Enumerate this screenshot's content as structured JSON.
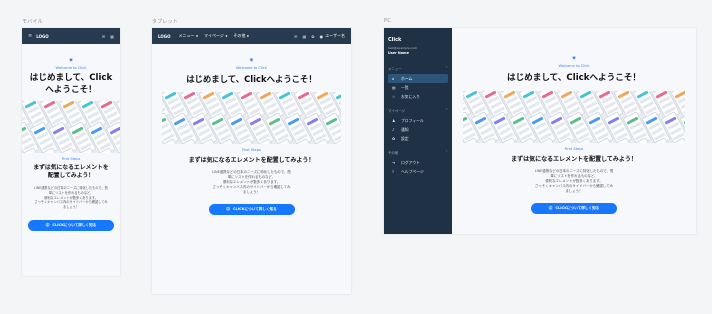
{
  "labels": {
    "mobile": "モバイル",
    "tablet": "タブレット",
    "pc": "PC"
  },
  "brand": {
    "logo": "LOGO",
    "app_name": "Click",
    "email": "test@example.com",
    "user_name": "User Name"
  },
  "nav": {
    "menu": "メニュー",
    "mypage": "マイページ",
    "other": "その他",
    "user_menu": "ユーザー名"
  },
  "content": {
    "welcome": "Welcome to Click",
    "title": "はじめまして、Clickへようこそ！",
    "title_mobile_1": "はじめまして、Click",
    "title_mobile_2": "へようこそ！",
    "steps_label": "First Steps",
    "subtitle": "まずは気になるエレメントを配置してみよう！",
    "subtitle_mobile_1": "まずは気になるエレメントを",
    "subtitle_mobile_2": "配置してみよう！",
    "desc_1": "LINE連携などの日本のニーズに特化したもので、簡",
    "desc_2": "単にリストを作れるものなど、",
    "desc_3": "便利なエレメントが数多くあります。",
    "desc_4": "さっそくキャンバス内のサイドバーから確認してみ",
    "desc_5": "ましょう！",
    "cta": "CLICKについて詳しく知る"
  },
  "sidebar": {
    "menu_section": "メニュー",
    "mypage_section": "マイページ",
    "other_section": "その他",
    "menu_items": [
      {
        "label": "ホーム",
        "icon": "home-icon",
        "active": true
      },
      {
        "label": "一覧",
        "icon": "list-icon",
        "active": false
      },
      {
        "label": "お気に入り",
        "icon": "star-icon",
        "active": false
      }
    ],
    "mypage_items": [
      {
        "label": "プロフィール",
        "icon": "user-icon"
      },
      {
        "label": "通知",
        "icon": "bell-icon"
      },
      {
        "label": "設定",
        "icon": "gear-icon"
      }
    ],
    "other_items": [
      {
        "label": "ログアウト",
        "icon": "logout-icon"
      },
      {
        "label": "ヘルプページ",
        "icon": "help-icon"
      }
    ]
  },
  "colors": {
    "header": "#283a4d",
    "sidebar": "#1f3245",
    "accent": "#1677ff",
    "active_item": "#2d557a"
  }
}
